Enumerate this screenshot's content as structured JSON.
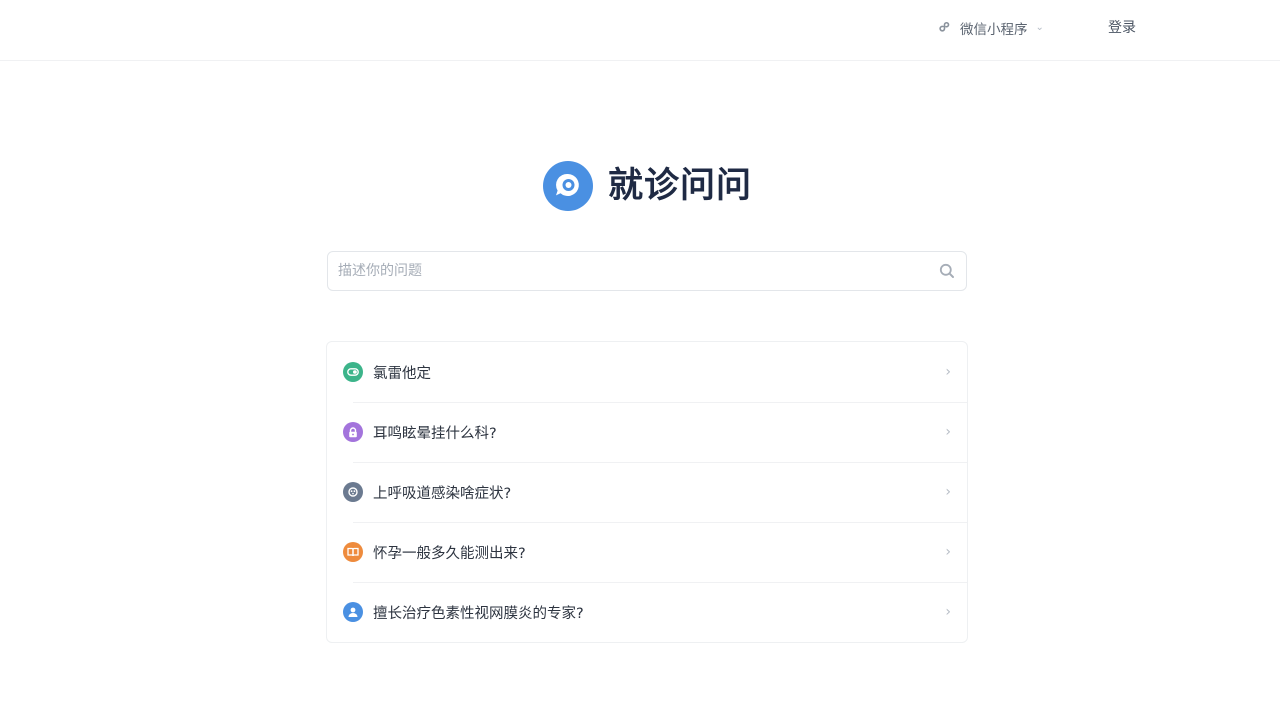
{
  "header": {
    "mini_program_label": "微信小程序",
    "login_label": "登录"
  },
  "brand": {
    "title": "就诊问问",
    "logo_color": "#4a90e2"
  },
  "search": {
    "placeholder": "描述你的问题"
  },
  "questions": [
    {
      "text": "氯雷他定",
      "icon": "pill-icon",
      "color": "#3cb48a"
    },
    {
      "text": "耳鸣眩晕挂什么科?",
      "icon": "lock-icon",
      "color": "#a374dc"
    },
    {
      "text": "上呼吸道感染啥症状?",
      "icon": "virus-icon",
      "color": "#6b7a90"
    },
    {
      "text": "怀孕一般多久能测出来?",
      "icon": "book-icon",
      "color": "#ee8b3d"
    },
    {
      "text": "擅长治疗色素性视网膜炎的专家?",
      "icon": "doctor-icon",
      "color": "#4a90e2"
    }
  ]
}
